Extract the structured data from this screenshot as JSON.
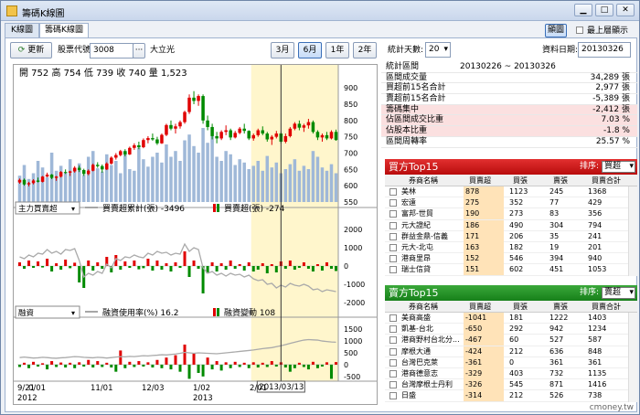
{
  "window": {
    "title": "籌碼K線圖"
  },
  "tabs": [
    {
      "label": "K線圖"
    },
    {
      "label": "籌碼K線圖"
    }
  ],
  "toolbar": {
    "refresh_label": "更新",
    "code_label": "股票代號:",
    "code_value": "3008",
    "ellipsis": "···",
    "stock_name": "大立光",
    "range_buttons": [
      "3月",
      "6月",
      "1年",
      "2年"
    ],
    "active_range": "6月",
    "stat_days_label": "統計天數:",
    "stat_days_value": "20",
    "date_label": "資料日期:",
    "date_value": "20130326",
    "big_print_label": "顯圖",
    "top_label": "最上層顯示"
  },
  "chart_data": [
    {
      "type": "bar",
      "title": "開 752 高 754 低 739 收 740 量 1,523",
      "yticks": [
        550,
        600,
        650,
        700,
        750,
        800,
        850,
        900
      ],
      "ylim": [
        550,
        920
      ],
      "candles": [
        [
          610,
          622,
          606,
          618
        ],
        [
          618,
          622,
          600,
          604
        ],
        [
          604,
          612,
          598,
          608
        ],
        [
          608,
          620,
          604,
          616
        ],
        [
          616,
          625,
          610,
          612
        ],
        [
          612,
          630,
          610,
          628
        ],
        [
          628,
          640,
          626,
          634
        ],
        [
          634,
          636,
          620,
          624
        ],
        [
          624,
          630,
          615,
          628
        ],
        [
          628,
          645,
          625,
          642
        ],
        [
          642,
          650,
          636,
          640
        ],
        [
          640,
          646,
          630,
          644
        ],
        [
          644,
          660,
          640,
          655
        ],
        [
          655,
          662,
          642,
          648
        ],
        [
          648,
          652,
          630,
          636
        ],
        [
          636,
          650,
          632,
          646
        ],
        [
          646,
          668,
          644,
          664
        ],
        [
          664,
          672,
          655,
          660
        ],
        [
          660,
          665,
          640,
          650
        ],
        [
          650,
          672,
          648,
          668
        ],
        [
          668,
          690,
          665,
          686
        ],
        [
          686,
          700,
          680,
          694
        ],
        [
          694,
          710,
          690,
          706
        ],
        [
          706,
          712,
          690,
          696
        ],
        [
          696,
          720,
          694,
          716
        ],
        [
          716,
          730,
          710,
          724
        ],
        [
          724,
          735,
          712,
          718
        ],
        [
          718,
          745,
          715,
          740
        ],
        [
          740,
          752,
          730,
          746
        ],
        [
          746,
          760,
          738,
          742
        ],
        [
          742,
          750,
          725,
          730
        ],
        [
          730,
          760,
          728,
          756
        ],
        [
          756,
          790,
          752,
          786
        ],
        [
          786,
          800,
          770,
          775
        ],
        [
          775,
          790,
          760,
          782
        ],
        [
          782,
          800,
          775,
          795
        ],
        [
          795,
          830,
          790,
          826
        ],
        [
          826,
          880,
          820,
          870
        ],
        [
          870,
          890,
          850,
          860
        ],
        [
          860,
          880,
          845,
          875
        ],
        [
          875,
          880,
          790,
          800
        ],
        [
          800,
          815,
          770,
          780
        ],
        [
          780,
          790,
          742,
          752
        ],
        [
          752,
          765,
          730,
          745
        ],
        [
          745,
          770,
          740,
          765
        ],
        [
          765,
          785,
          755,
          770
        ],
        [
          770,
          775,
          740,
          748
        ],
        [
          748,
          768,
          745,
          762
        ],
        [
          762,
          780,
          758,
          775
        ],
        [
          775,
          790,
          760,
          768
        ],
        [
          768,
          770,
          740,
          745
        ],
        [
          745,
          760,
          738,
          755
        ],
        [
          755,
          775,
          750,
          770
        ],
        [
          770,
          782,
          755,
          760
        ],
        [
          760,
          765,
          735,
          742
        ],
        [
          742,
          755,
          725,
          750
        ],
        [
          750,
          768,
          745,
          760
        ],
        [
          760,
          765,
          730,
          735
        ],
        [
          735,
          760,
          730,
          752
        ],
        [
          752,
          780,
          748,
          775
        ],
        [
          775,
          795,
          770,
          790
        ],
        [
          790,
          800,
          770,
          778
        ],
        [
          778,
          790,
          765,
          785
        ],
        [
          785,
          805,
          775,
          795
        ],
        [
          795,
          800,
          760,
          765
        ],
        [
          765,
          770,
          740,
          748
        ],
        [
          748,
          760,
          735,
          755
        ],
        [
          755,
          765,
          740,
          745
        ],
        [
          745,
          770,
          742,
          765
        ],
        [
          765,
          772,
          738,
          740
        ]
      ],
      "volume_rel": [
        0.32,
        0.45,
        0.28,
        0.35,
        0.5,
        0.42,
        0.3,
        0.6,
        0.38,
        0.44,
        0.36,
        0.52,
        0.4,
        0.47,
        0.33,
        0.55,
        0.62,
        0.41,
        0.37,
        0.58,
        0.45,
        0.5,
        0.35,
        0.62,
        0.4,
        0.38,
        0.66,
        0.52,
        0.43,
        0.55,
        0.6,
        0.48,
        0.7,
        0.55,
        0.62,
        0.5,
        0.75,
        0.82,
        0.68,
        0.6,
        0.9,
        0.72,
        0.8,
        0.55,
        0.5,
        0.62,
        0.58,
        0.45,
        0.52,
        0.48,
        0.4,
        0.44,
        0.5,
        0.38,
        0.56,
        0.42,
        0.48,
        0.35,
        0.4,
        0.46,
        0.52,
        0.38,
        0.44,
        0.4,
        0.62,
        0.55,
        0.42,
        0.38,
        0.46,
        0.35
      ]
    },
    {
      "type": "bar",
      "selector": "主力買賣超",
      "legend": [
        {
          "name": "買賣超累計(張)",
          "value": "-3496"
        },
        {
          "name": "買賣超(張)",
          "value": "-274"
        }
      ],
      "yticks": [
        2000,
        1000,
        0,
        -1000,
        -2000
      ],
      "ylim": [
        -2500,
        2500
      ],
      "values": [
        200,
        -150,
        300,
        -100,
        250,
        -80,
        400,
        -300,
        150,
        -200,
        350,
        -120,
        180,
        -900,
        -1200,
        300,
        -250,
        200,
        -150,
        500,
        -350,
        600,
        -200,
        250,
        -100,
        300,
        -180,
        -120,
        400,
        -250,
        300,
        -200,
        150,
        -300,
        200,
        -100,
        800,
        -600,
        300,
        -150,
        -1500,
        -400,
        200,
        -300,
        150,
        -200,
        300,
        -150,
        100,
        -250,
        200,
        -300,
        -200,
        150,
        -400,
        100,
        -350,
        250,
        -150,
        300,
        -200,
        -100,
        200,
        -150,
        -300,
        100,
        -250,
        200,
        -150,
        -274
      ],
      "line": [
        500,
        400,
        600,
        500,
        700,
        650,
        900,
        700,
        800,
        650,
        900,
        850,
        950,
        300,
        -600,
        -400,
        -500,
        -300,
        -400,
        100,
        -100,
        400,
        300,
        500,
        450,
        600,
        500,
        450,
        700,
        600,
        800,
        700,
        750,
        600,
        700,
        650,
        1200,
        800,
        1000,
        900,
        -100,
        -400,
        -300,
        -500,
        -400,
        -550,
        -400,
        -500,
        -450,
        -600,
        -500,
        -700,
        -800,
        -750,
        -1000,
        -950,
        -1200,
        -1050,
        -1150,
        -950,
        -1050,
        -1100,
        -1000,
        -1100,
        -1300,
        -1250,
        -1400,
        -1300,
        -1350,
        -1400
      ]
    },
    {
      "type": "bar",
      "selector": "融資",
      "legend": [
        {
          "name": "融資使用率(%)",
          "value": "16.2"
        },
        {
          "name": "融資變動",
          "value": "108"
        }
      ],
      "yticks": [
        1500,
        1000,
        500,
        0,
        -500
      ],
      "ylim": [
        -700,
        1700
      ],
      "values": [
        -100,
        80,
        -150,
        120,
        -80,
        60,
        -200,
        150,
        -100,
        90,
        -120,
        80,
        -150,
        100,
        -80,
        200,
        -120,
        150,
        -100,
        80,
        -120,
        -300,
        600,
        -150,
        120,
        -100,
        150,
        -80,
        100,
        -120,
        200,
        -150,
        300,
        -200,
        400,
        -300,
        850,
        -600,
        500,
        -350,
        -500,
        300,
        -200,
        150,
        -250,
        100,
        -150,
        120,
        -100,
        80,
        -150,
        100,
        -120,
        80,
        -100,
        150,
        -80,
        100,
        -120,
        -300,
        -150,
        80,
        -100,
        -200,
        120,
        -150,
        -80,
        100,
        -600,
        108
      ],
      "line": [
        300,
        320,
        300,
        280,
        290,
        310,
        300,
        280,
        270,
        290,
        300,
        320,
        340,
        330,
        310,
        300,
        290,
        310,
        300,
        280,
        300,
        320,
        340,
        330,
        350,
        340,
        360,
        380,
        370,
        390,
        400,
        420,
        410,
        430,
        450,
        480,
        520,
        500,
        480,
        500,
        490,
        480,
        470,
        460,
        480,
        500,
        520,
        540,
        560,
        580,
        600,
        620,
        650,
        680,
        700,
        720,
        760,
        800,
        850,
        900,
        950,
        1000,
        1040,
        1060,
        1050,
        1040,
        1000,
        980,
        960,
        950
      ]
    }
  ],
  "x_axis": {
    "labels": [
      "9/21",
      "0/01",
      "11/01",
      "12/03",
      "1/02",
      "2/01"
    ],
    "years": [
      "2012",
      "2013"
    ],
    "cursor_label": "2013/03/13"
  },
  "stats": {
    "rows": [
      {
        "k": "統計區間",
        "v": "20130226 ~ 20130326"
      },
      {
        "k": "區間成交量",
        "v": "34,289 張"
      },
      {
        "k": "買超前15名合計",
        "v": "2,977 張"
      },
      {
        "k": "賣超前15名合計",
        "v": "-5,389 張"
      },
      {
        "k": "籌碼集中",
        "v": "-2,412 張"
      },
      {
        "k": "佔區間成交比重",
        "v": "7.03 %"
      },
      {
        "k": "佔股本比重",
        "v": "-1.8 %"
      },
      {
        "k": "區間周轉率",
        "v": "25.57 %"
      }
    ]
  },
  "buy_panel": {
    "title": "買方Top15",
    "sort_label": "排序:",
    "sort_value": "買超",
    "headers": [
      "券商名稱",
      "買賣超",
      "買張",
      "賣張",
      "買賣合計"
    ],
    "rows": [
      [
        "美林",
        "878",
        "1123",
        "245",
        "1368"
      ],
      [
        "宏遠",
        "275",
        "352",
        "77",
        "429"
      ],
      [
        "富邦-世貿",
        "190",
        "273",
        "83",
        "356"
      ],
      [
        "元大證紀",
        "186",
        "490",
        "304",
        "794"
      ],
      [
        "群益金鼎-信義",
        "171",
        "206",
        "35",
        "241"
      ],
      [
        "元大-北屯",
        "163",
        "182",
        "19",
        "201"
      ],
      [
        "港商里昂",
        "152",
        "546",
        "394",
        "940"
      ],
      [
        "瑞士信貸",
        "151",
        "602",
        "451",
        "1053"
      ]
    ]
  },
  "sell_panel": {
    "title": "賣方Top15",
    "sort_label": "排序:",
    "sort_value": "賣超",
    "headers": [
      "券商名稱",
      "買賣超",
      "買張",
      "賣張",
      "買賣合計"
    ],
    "rows": [
      [
        "美商高盛",
        "-1041",
        "181",
        "1222",
        "1403"
      ],
      [
        "凱基-台北",
        "-650",
        "292",
        "942",
        "1234"
      ],
      [
        "港商野村台北分...",
        "-467",
        "60",
        "527",
        "587"
      ],
      [
        "摩根大通",
        "-424",
        "212",
        "636",
        "848"
      ],
      [
        "台灣巴克萊",
        "-361",
        "0",
        "361",
        "361"
      ],
      [
        "港商德意志",
        "-329",
        "403",
        "732",
        "1135"
      ],
      [
        "台灣摩根士丹利",
        "-326",
        "545",
        "871",
        "1416"
      ],
      [
        "日盛",
        "-314",
        "212",
        "526",
        "738"
      ]
    ]
  },
  "colors": {
    "buy_header": "#cc1111",
    "sell_header": "#1f8a1f",
    "up": "#e00000",
    "down": "#008a00",
    "volume": "#9fb8d8",
    "highlight": "#fff6cc"
  },
  "watermark": "cmoney.tw"
}
